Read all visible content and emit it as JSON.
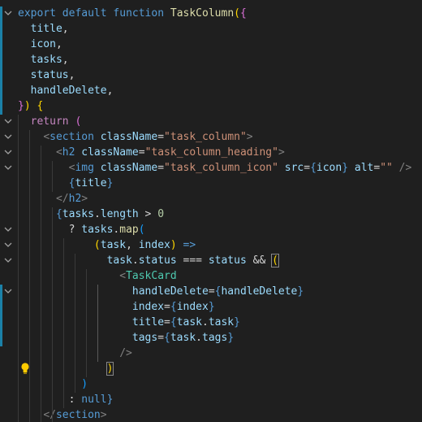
{
  "editor": {
    "lines": [
      [
        {
          "t": "export",
          "c": "kw"
        },
        {
          "t": " "
        },
        {
          "t": "default",
          "c": "kw"
        },
        {
          "t": " "
        },
        {
          "t": "function",
          "c": "kw"
        },
        {
          "t": " "
        },
        {
          "t": "TaskColumn",
          "c": "fn"
        },
        {
          "t": "(",
          "c": "b1"
        },
        {
          "t": "{",
          "c": "b2"
        }
      ],
      [
        {
          "t": "  "
        },
        {
          "t": "title",
          "c": "var"
        },
        {
          "t": ",",
          "c": "txt"
        }
      ],
      [
        {
          "t": "  "
        },
        {
          "t": "icon",
          "c": "var"
        },
        {
          "t": ",",
          "c": "txt"
        }
      ],
      [
        {
          "t": "  "
        },
        {
          "t": "tasks",
          "c": "var"
        },
        {
          "t": ",",
          "c": "txt"
        }
      ],
      [
        {
          "t": "  "
        },
        {
          "t": "status",
          "c": "var"
        },
        {
          "t": ",",
          "c": "txt"
        }
      ],
      [
        {
          "t": "  "
        },
        {
          "t": "handleDelete",
          "c": "var"
        },
        {
          "t": ",",
          "c": "txt"
        }
      ],
      [
        {
          "t": "}",
          "c": "b2"
        },
        {
          "t": ")",
          "c": "b1"
        },
        {
          "t": " "
        },
        {
          "t": "{",
          "c": "b1"
        }
      ],
      [
        {
          "t": "  "
        },
        {
          "t": "return",
          "c": "ctl"
        },
        {
          "t": " "
        },
        {
          "t": "(",
          "c": "b2"
        }
      ],
      [
        {
          "t": "    "
        },
        {
          "t": "<",
          "c": "punc"
        },
        {
          "t": "section",
          "c": "tag"
        },
        {
          "t": " "
        },
        {
          "t": "className",
          "c": "attr"
        },
        {
          "t": "=",
          "c": "txt"
        },
        {
          "t": "\"task_column\"",
          "c": "str"
        },
        {
          "t": ">",
          "c": "punc"
        }
      ],
      [
        {
          "t": "      "
        },
        {
          "t": "<",
          "c": "punc"
        },
        {
          "t": "h2",
          "c": "tag"
        },
        {
          "t": " "
        },
        {
          "t": "className",
          "c": "attr"
        },
        {
          "t": "=",
          "c": "txt"
        },
        {
          "t": "\"task_column_heading\"",
          "c": "str"
        },
        {
          "t": ">",
          "c": "punc"
        }
      ],
      [
        {
          "t": "        "
        },
        {
          "t": "<",
          "c": "punc"
        },
        {
          "t": "img",
          "c": "tag"
        },
        {
          "t": " "
        },
        {
          "t": "className",
          "c": "attr"
        },
        {
          "t": "=",
          "c": "txt"
        },
        {
          "t": "\"task_column_icon\"",
          "c": "str"
        },
        {
          "t": " "
        },
        {
          "t": "src",
          "c": "attr"
        },
        {
          "t": "=",
          "c": "txt"
        },
        {
          "t": "{",
          "c": "kw"
        },
        {
          "t": "icon",
          "c": "var"
        },
        {
          "t": "}",
          "c": "kw"
        },
        {
          "t": " "
        },
        {
          "t": "alt",
          "c": "attr"
        },
        {
          "t": "=",
          "c": "txt"
        },
        {
          "t": "\"\"",
          "c": "str"
        },
        {
          "t": " "
        },
        {
          "t": "/>",
          "c": "punc"
        }
      ],
      [
        {
          "t": "        "
        },
        {
          "t": "{",
          "c": "kw"
        },
        {
          "t": "title",
          "c": "var"
        },
        {
          "t": "}",
          "c": "kw"
        }
      ],
      [
        {
          "t": "      "
        },
        {
          "t": "</",
          "c": "punc"
        },
        {
          "t": "h2",
          "c": "tag"
        },
        {
          "t": ">",
          "c": "punc"
        }
      ],
      [
        {
          "t": "      "
        },
        {
          "t": "{",
          "c": "kw"
        },
        {
          "t": "tasks",
          "c": "var"
        },
        {
          "t": ".",
          "c": "txt"
        },
        {
          "t": "length",
          "c": "var"
        },
        {
          "t": " > ",
          "c": "txt"
        },
        {
          "t": "0",
          "c": "num"
        }
      ],
      [
        {
          "t": "        "
        },
        {
          "t": "? ",
          "c": "txt"
        },
        {
          "t": "tasks",
          "c": "var"
        },
        {
          "t": ".",
          "c": "txt"
        },
        {
          "t": "map",
          "c": "fn"
        },
        {
          "t": "(",
          "c": "b3"
        }
      ],
      [
        {
          "t": "            "
        },
        {
          "t": "(",
          "c": "b1"
        },
        {
          "t": "task",
          "c": "var"
        },
        {
          "t": ", ",
          "c": "txt"
        },
        {
          "t": "index",
          "c": "var"
        },
        {
          "t": ")",
          "c": "b1"
        },
        {
          "t": " "
        },
        {
          "t": "=>",
          "c": "kw"
        }
      ],
      [
        {
          "t": "              "
        },
        {
          "t": "task",
          "c": "var"
        },
        {
          "t": ".",
          "c": "txt"
        },
        {
          "t": "status",
          "c": "var"
        },
        {
          "t": " === ",
          "c": "txt"
        },
        {
          "t": "status",
          "c": "var"
        },
        {
          "t": " && ",
          "c": "txt"
        },
        {
          "t": "(",
          "c": "b1",
          "m": true
        }
      ],
      [
        {
          "t": "                "
        },
        {
          "t": "<",
          "c": "punc"
        },
        {
          "t": "TaskCard",
          "c": "comp"
        }
      ],
      [
        {
          "t": "                  "
        },
        {
          "t": "handleDelete",
          "c": "attr"
        },
        {
          "t": "=",
          "c": "txt"
        },
        {
          "t": "{",
          "c": "kw"
        },
        {
          "t": "handleDelete",
          "c": "var"
        },
        {
          "t": "}",
          "c": "kw"
        }
      ],
      [
        {
          "t": "                  "
        },
        {
          "t": "index",
          "c": "attr"
        },
        {
          "t": "=",
          "c": "txt"
        },
        {
          "t": "{",
          "c": "kw"
        },
        {
          "t": "index",
          "c": "var"
        },
        {
          "t": "}",
          "c": "kw"
        }
      ],
      [
        {
          "t": "                  "
        },
        {
          "t": "title",
          "c": "attr"
        },
        {
          "t": "=",
          "c": "txt"
        },
        {
          "t": "{",
          "c": "kw"
        },
        {
          "t": "task",
          "c": "var"
        },
        {
          "t": ".",
          "c": "txt"
        },
        {
          "t": "task",
          "c": "var"
        },
        {
          "t": "}",
          "c": "kw"
        }
      ],
      [
        {
          "t": "                  "
        },
        {
          "t": "tags",
          "c": "attr"
        },
        {
          "t": "=",
          "c": "txt"
        },
        {
          "t": "{",
          "c": "kw"
        },
        {
          "t": "task",
          "c": "var"
        },
        {
          "t": ".",
          "c": "txt"
        },
        {
          "t": "tags",
          "c": "var"
        },
        {
          "t": "}",
          "c": "kw"
        }
      ],
      [
        {
          "t": "                "
        },
        {
          "t": "/>",
          "c": "punc"
        }
      ],
      [
        {
          "t": "              "
        },
        {
          "t": ")",
          "c": "b1",
          "m": true
        }
      ],
      [
        {
          "t": "          "
        },
        {
          "t": ")",
          "c": "b3"
        }
      ],
      [
        {
          "t": "        "
        },
        {
          "t": ": ",
          "c": "txt"
        },
        {
          "t": "null",
          "c": "kw"
        },
        {
          "t": "}",
          "c": "kw"
        }
      ],
      [
        {
          "t": "    "
        },
        {
          "t": "</",
          "c": "punc"
        },
        {
          "t": "section",
          "c": "tag"
        },
        {
          "t": ">",
          "c": "punc"
        }
      ]
    ]
  },
  "colors": {
    "background": "#1f1f1f",
    "keyword": "#569cd6",
    "control": "#c586c0",
    "function": "#dcdcaa",
    "variable": "#9cdcfe",
    "string": "#ce9178",
    "component": "#4ec9b0",
    "bracket1": "#ffd700",
    "bracket2": "#da70d6",
    "bracket3": "#179fff",
    "lightbulb": "#ffcc00",
    "modified_bar": "#1b81a8"
  },
  "icons": {
    "fold": "chevron-down-icon",
    "quick_fix": "lightbulb-icon"
  }
}
